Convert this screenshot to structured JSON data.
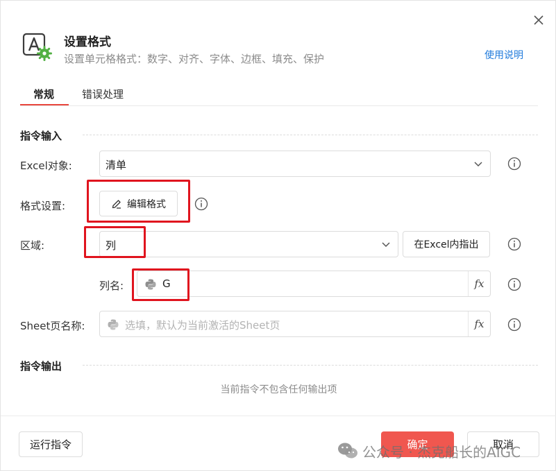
{
  "dialog": {
    "title": "设置格式",
    "subtitle": "设置单元格格式：数字、对齐、字体、边框、填充、保护",
    "help_link": "使用说明",
    "header_icon": "text-format-gear-icon"
  },
  "tabs": [
    {
      "label": "常规",
      "active": true
    },
    {
      "label": "错误处理",
      "active": false
    }
  ],
  "input_section": {
    "title": "指令输入",
    "excel_object": {
      "label": "Excel对象:",
      "value": "清单"
    },
    "format_setting": {
      "label": "格式设置:",
      "button_label": "编辑格式"
    },
    "area": {
      "label": "区域:",
      "value": "列",
      "locate_button": "在Excel内指出"
    },
    "column_name": {
      "label": "列名:",
      "value": "G"
    },
    "sheet_name": {
      "label": "Sheet页名称:",
      "placeholder": "选填，默认为当前激活的Sheet页"
    }
  },
  "output_section": {
    "title": "指令输出",
    "empty_text": "当前指令不包含任何输出项"
  },
  "footer": {
    "run_button": "运行指令",
    "ok_button": "确定",
    "cancel_button": "取消"
  },
  "watermark": {
    "text": "公众号 · 杰克船长的AIGC"
  },
  "colors": {
    "accent_red": "#e8453c",
    "ok_button": "#f0574f",
    "link_blue": "#1f7adb",
    "highlight_box": "#e0141e"
  }
}
